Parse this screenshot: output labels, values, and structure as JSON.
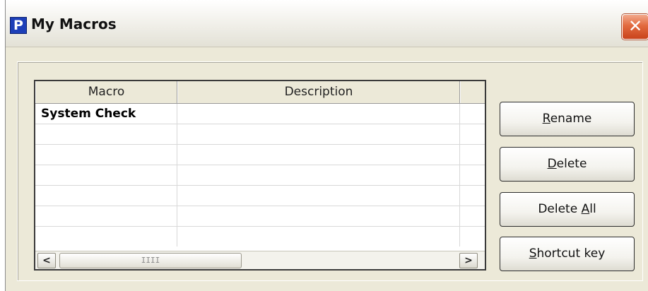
{
  "window": {
    "title": "My Macros",
    "app_icon_letter": "P",
    "close_glyph": "✕"
  },
  "table": {
    "columns": [
      "Macro",
      "Description"
    ],
    "rows": [
      {
        "macro": "System Check",
        "description": ""
      }
    ],
    "scroll_left_glyph": "<",
    "scroll_right_glyph": ">",
    "thumb_grip": "IIII"
  },
  "buttons": {
    "rename": {
      "pre": "",
      "mnemonic": "R",
      "post": "ename"
    },
    "delete": {
      "pre": "",
      "mnemonic": "D",
      "post": "elete"
    },
    "delete_all": {
      "pre": "Delete ",
      "mnemonic": "A",
      "post": "ll"
    },
    "shortcut_key": {
      "pre": "",
      "mnemonic": "S",
      "post": "hortcut key"
    }
  },
  "icons": {
    "app": "app-p-icon",
    "close": "close-icon",
    "scroll_left": "chevron-left-icon",
    "scroll_right": "chevron-right-icon"
  },
  "colors": {
    "close_button": "#e26a3f",
    "app_icon": "#1d3fb8",
    "dialog_face": "#ece9d8"
  }
}
